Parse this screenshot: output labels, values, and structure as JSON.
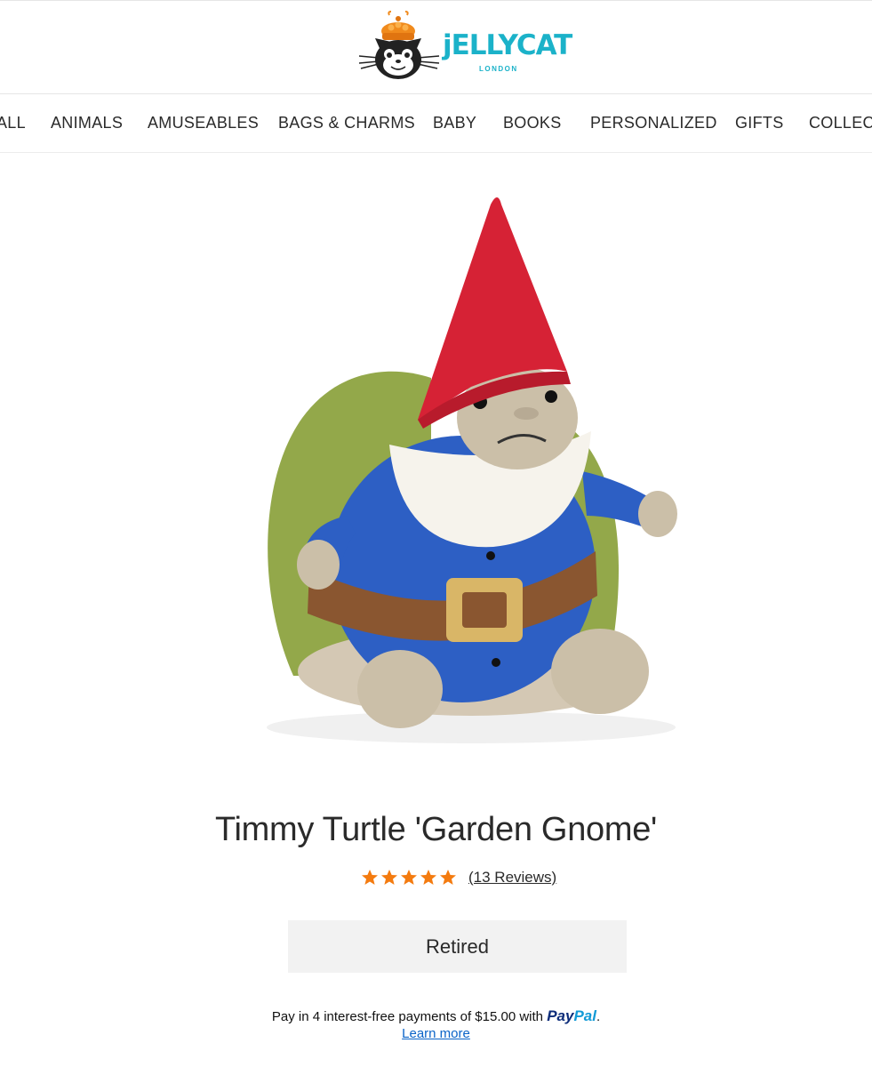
{
  "brand": {
    "name": "jELLYCAT",
    "sub": "LONDON",
    "color": "#1bb2c9",
    "hat_color": "#f08a1c"
  },
  "nav": {
    "items": [
      {
        "label": "ALL"
      },
      {
        "label": "ANIMALS"
      },
      {
        "label": "AMUSEABLES"
      },
      {
        "label": "BAGS & CHARMS"
      },
      {
        "label": "BABY"
      },
      {
        "label": "BOOKS"
      },
      {
        "label": "PERSONALIZED"
      },
      {
        "label": "GIFTS"
      },
      {
        "label": "COLLECT"
      }
    ]
  },
  "product": {
    "image_subject": "plush turtle in garden gnome costume",
    "title": "Timmy Turtle 'Garden Gnome'",
    "rating": 5,
    "rating_max": 5,
    "star_color": "#f47b0f",
    "reviews_label": "(13 Reviews)",
    "status_label": "Retired"
  },
  "paypal": {
    "text": "Pay in 4 interest-free payments of $15.00 with",
    "brand_a": "Pay",
    "brand_b": "Pal",
    "period": ".",
    "learn_more": "Learn more"
  }
}
